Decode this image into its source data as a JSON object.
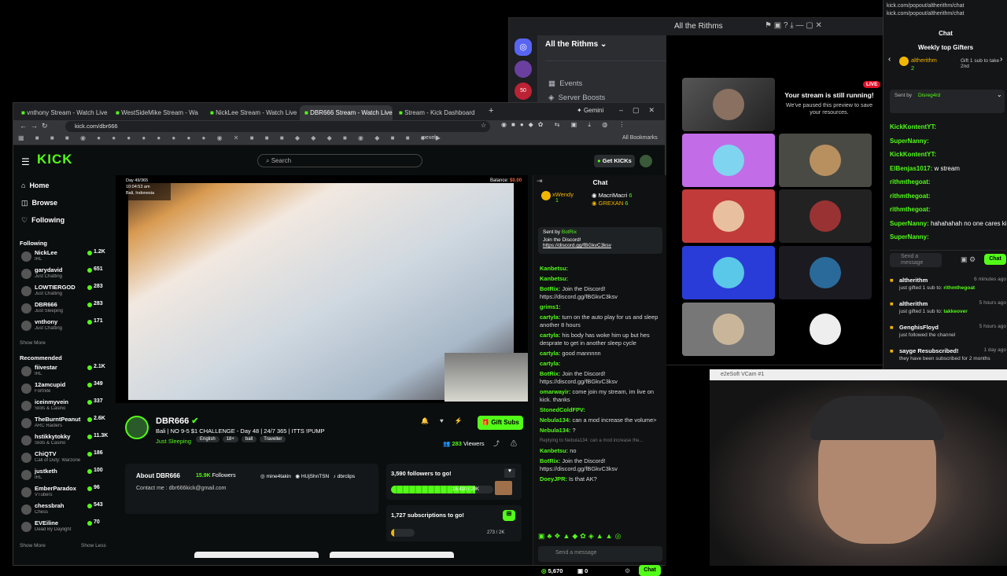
{
  "discord": {
    "server_name": "All the Rithms",
    "window_title": "All the Rithms",
    "menu": [
      "Events",
      "Server Boosts"
    ],
    "badge": "50",
    "preview_live": "LIVE",
    "preview_title": "Your stream is still running!",
    "preview_text": "We've paused this preview to save your resources."
  },
  "popout": {
    "url": "kick.com/popout/altherithm/chat",
    "title": "Chat",
    "gifters_title": "Weekly top Gifters",
    "gifter_name": "altherithm",
    "gifter_count": "2",
    "gifter_note": "Gift 1 sub to take 2nd",
    "sent_by": "Sent by",
    "sent_by_user": "Disreg4rd",
    "messages": [
      {
        "user": "KickKontentYT:",
        "text": ""
      },
      {
        "user": "SuperNanny:",
        "text": ""
      },
      {
        "user": "KickKontentYT:",
        "text": ""
      },
      {
        "user": "ElBenjas1017:",
        "text": "w stream"
      },
      {
        "user": "rithmthegoat:",
        "text": ""
      },
      {
        "user": "rithmthegoat:",
        "text": ""
      },
      {
        "user": "rithmthegoat:",
        "text": ""
      },
      {
        "user": "SuperNanny:",
        "text": "hahahahah no one cares king"
      },
      {
        "user": "SuperNanny:",
        "text": ""
      }
    ],
    "input_placeholder": "Send a message",
    "chat_button": "Chat",
    "events": [
      {
        "user": "altherithm",
        "time": "6 minutes ago",
        "text": "just gifted 1 sub to:",
        "target": "rithmthegoat"
      },
      {
        "user": "altherithm",
        "time": "5 hours ago",
        "text": "just gifted 1 sub to:",
        "target": "takkeover"
      },
      {
        "user": "GenghisFloyd",
        "time": "5 hours ago",
        "text": "just followed the channel",
        "target": ""
      },
      {
        "user": "sayge Resubscribed!",
        "time": "1 day ago",
        "text": "they have been subscribed for 2 months",
        "target": ""
      }
    ]
  },
  "webcam": {
    "title": "e2eSoft VCam #1"
  },
  "browser": {
    "tabs": [
      "vnthony Stream - Watch Live o",
      "WestSideMike Stream - Wa",
      "NickLee Stream - Watch Live o",
      "DBR666 Stream - Watch Live o",
      "Stream - Kick Dashboard"
    ],
    "gemini": "Gemini",
    "url": "kick.com/dbr666",
    "bookmarks_label": "pexels",
    "all_bookmarks": "All Bookmarks"
  },
  "kick": {
    "search_placeholder": "Search",
    "get_kicks": "Get KICKs",
    "nav": [
      "Home",
      "Browse",
      "Following"
    ],
    "following_label": "Following",
    "following": [
      {
        "name": "NickLee",
        "sub": "IRL",
        "viewers": "1.2K"
      },
      {
        "name": "garydavid",
        "sub": "Just Chatting",
        "viewers": "651"
      },
      {
        "name": "LOWTIERGOD",
        "sub": "Just Chatting",
        "viewers": "283"
      },
      {
        "name": "DBR666",
        "sub": "Just Sleeping",
        "viewers": "283"
      },
      {
        "name": "vnthony",
        "sub": "Just Chatting",
        "viewers": "171"
      }
    ],
    "show_more": "Show More",
    "recommended_label": "Recommended",
    "recommended": [
      {
        "name": "fiivestar",
        "sub": "IRL",
        "viewers": "2.1K"
      },
      {
        "name": "12amcupid",
        "sub": "Fortnite",
        "viewers": "349"
      },
      {
        "name": "iceinmyvein",
        "sub": "Slots & Casino",
        "viewers": "337"
      },
      {
        "name": "TheBurntPeanut",
        "sub": "ARC Raiders",
        "viewers": "2.6K"
      },
      {
        "name": "hstikkytokky",
        "sub": "Slots & Casino",
        "viewers": "11.3K"
      },
      {
        "name": "ChiQTV",
        "sub": "Call of Duty: Warzone",
        "viewers": "186"
      },
      {
        "name": "justketh",
        "sub": "IRL",
        "viewers": "100"
      },
      {
        "name": "EmberParadox",
        "sub": "VTubers",
        "viewers": "96"
      },
      {
        "name": "chessbrah",
        "sub": "Chess",
        "viewers": "543"
      },
      {
        "name": "EVEiline",
        "sub": "Dead By Daylight",
        "viewers": "70"
      }
    ],
    "show_more2": "Show More",
    "show_less": "Show Less",
    "overlay_day": "Day 49/365",
    "overlay_time": "10:04:53 am",
    "overlay_loc": "Bali, Indonesia",
    "balance_label": "Balance:",
    "balance_value": "$0.00",
    "streamer": "DBR666",
    "stream_title": "Bali | NO 9-5 $1 CHALLENGE - Day 48 | 24/7 365 | ITTS  !PUMP",
    "category": "Just Sleeping",
    "tags": [
      "English",
      "18+",
      "ball",
      "Traveller"
    ],
    "gift_subs": "Gift Subs",
    "viewers": "283",
    "viewers_label": "Viewers",
    "about_title": "About DBR666",
    "followers_count": "15.9K",
    "followers_label": "Followers",
    "contact": "Contact me : dbr666kick@gmail.com",
    "socials": [
      "mine4takin",
      "HUjShnTSN",
      "dbrclips"
    ],
    "goal1_text": "3,590 followers to go!",
    "goal1_progress": "16,410 / 20K",
    "goal1_fraction": 0.82,
    "goal2_text": "1,727 subscriptions to go!",
    "goal2_progress": "273 / 2K",
    "goal2_fraction": 0.14
  },
  "kickchat": {
    "title": "Chat",
    "gifter1": "xWendy",
    "gifter1_count": "1",
    "gifter2": "MacriMacri",
    "gifter2_count": "6",
    "gifter3": "GREXAN",
    "gifter3_count": "6",
    "pinned_by": "Sent by",
    "pinned_user": "BotRix",
    "pinned_text": "Join the Discord!",
    "pinned_link": "https://discord.gg/fBGkvC3ksv",
    "messages": [
      {
        "user": "Kanbetsu:",
        "text": ""
      },
      {
        "user": "Kanbetsu:",
        "text": ""
      },
      {
        "user": "BotRix:",
        "text": "Join the Discord! https://discord.gg/fBGkvC3ksv"
      },
      {
        "user": "grims1:",
        "text": ""
      },
      {
        "user": "cartyla:",
        "text": "turn on the auto play for us and sleep another 8 hours"
      },
      {
        "user": "cartyla:",
        "text": "his body has woke him up but hes desprate to get in another sleep cycle"
      },
      {
        "user": "cartyla:",
        "text": "good mannnnn"
      },
      {
        "user": "cartyla:",
        "text": ""
      },
      {
        "user": "BotRix:",
        "text": "Join the Discord! https://discord.gg/fBGkvC3ksv"
      },
      {
        "user": "omarwayir:",
        "text": "come join my stream, im live on kick. thanks"
      },
      {
        "user": "StonedColdFPV:",
        "text": ""
      },
      {
        "user": "Nebula134:",
        "text": "can a mod increase the volume>"
      },
      {
        "user": "Nebula134:",
        "text": "?"
      },
      {
        "user": "Kanbetsu:",
        "text": "no"
      },
      {
        "user": "BotRix:",
        "text": "Join the Discord! https://discord.gg/fBGkvC3ksv"
      },
      {
        "user": "DoeyJPR:",
        "text": "Is that AK?"
      }
    ],
    "reply_to": "Replying to Nebula134: can a mod increase the...",
    "input_placeholder": "Send a message",
    "kicks": "5,670",
    "zero": "0",
    "chat_button": "Chat"
  },
  "colors": {
    "accent": "#53fc18",
    "bg": "#0b0e0f",
    "discord_bg": "#111214"
  }
}
